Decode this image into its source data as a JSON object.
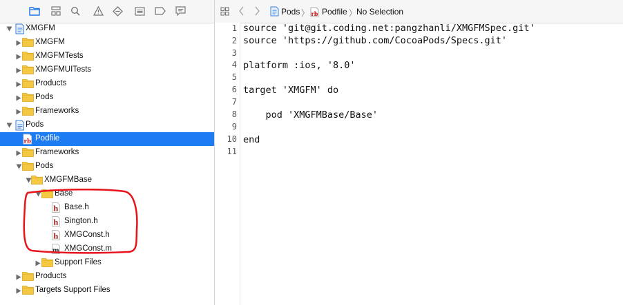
{
  "navigator": {
    "toolbar_icons": [
      "folder-icon",
      "hierarchy-icon",
      "search-icon",
      "warning-icon",
      "diamond-icon",
      "list-icon",
      "tag-icon",
      "comment-icon"
    ],
    "tree": [
      {
        "label": "XMGFM",
        "icon": "project",
        "expanded": true
      },
      {
        "label": "XMGFM",
        "icon": "folder",
        "expanded": false
      },
      {
        "label": "XMGFMTests",
        "icon": "folder",
        "expanded": false
      },
      {
        "label": "XMGFMUITests",
        "icon": "folder",
        "expanded": false
      },
      {
        "label": "Products",
        "icon": "folder",
        "expanded": false
      },
      {
        "label": "Pods",
        "icon": "folder",
        "expanded": false
      },
      {
        "label": "Frameworks",
        "icon": "folder",
        "expanded": false
      },
      {
        "label": "Pods",
        "icon": "project",
        "expanded": true
      },
      {
        "label": "Podfile",
        "icon": "rb-file",
        "selected": true
      },
      {
        "label": "Frameworks",
        "icon": "folder",
        "expanded": false
      },
      {
        "label": "Pods",
        "icon": "folder",
        "expanded": true
      },
      {
        "label": "XMGFMBase",
        "icon": "folder",
        "expanded": true
      },
      {
        "label": "Base",
        "icon": "folder",
        "expanded": true
      },
      {
        "label": "Base.h",
        "icon": "h-file"
      },
      {
        "label": "Sington.h",
        "icon": "h-file"
      },
      {
        "label": "XMGConst.h",
        "icon": "h-file"
      },
      {
        "label": "XMGConst.m",
        "icon": "m-file"
      },
      {
        "label": "Support Files",
        "icon": "folder",
        "expanded": false
      },
      {
        "label": "Products",
        "icon": "folder",
        "expanded": false
      },
      {
        "label": "Targets Support Files",
        "icon": "folder",
        "expanded": false
      }
    ]
  },
  "editor": {
    "breadcrumb": {
      "project": "Pods",
      "file": "Podfile",
      "selection": "No Selection"
    },
    "line_numbers": [
      "1",
      "2",
      "3",
      "4",
      "5",
      "6",
      "7",
      "8",
      "9",
      "10",
      "11"
    ],
    "lines": [
      "source 'git@git.coding.net:pangzhanli/XMGFMSpec.git'",
      "source 'https://github.com/CocoaPods/Specs.git'",
      "",
      "platform :ios, '8.0'",
      "",
      "target 'XMGFM' do",
      "",
      "    pod 'XMGFMBase/Base'",
      "",
      "end",
      ""
    ]
  },
  "colors": {
    "selection": "#1e7cf2",
    "folder": "#f5c842",
    "annotation": "#e8141c",
    "accent": "#1a73e8"
  }
}
